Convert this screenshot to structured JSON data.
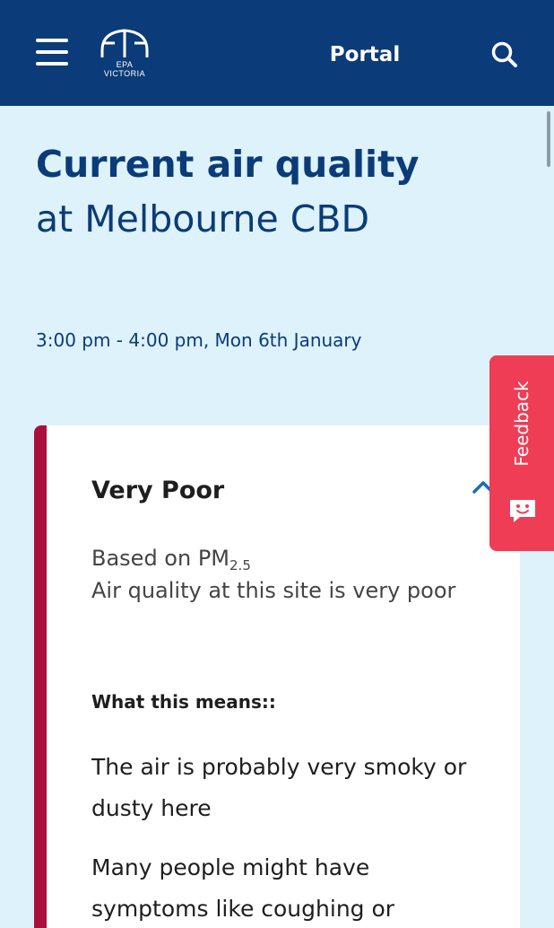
{
  "header": {
    "logo_primary": "EPA",
    "logo_secondary": "VICTORIA",
    "nav_link": "Portal",
    "icons": {
      "menu": "hamburger-menu-icon",
      "search": "search-icon"
    }
  },
  "page": {
    "title_strong": "Current air quality",
    "title_light": "at Melbourne CBD",
    "time_range": "3:00 pm - 4:00 pm, Mon 6th January"
  },
  "card": {
    "status": "Very Poor",
    "based_on": "Based on PM",
    "based_on_sub": "2.5",
    "description": "Air quality at this site is very poor",
    "means_heading": "What this means::",
    "paragraphs": [
      "The air is probably very smoky or dusty here",
      "Many people might have symptoms like coughing or"
    ],
    "accent_color": "#ab0f3b",
    "toggle_icon": "chevron-up-icon"
  },
  "feedback": {
    "label": "Feedback",
    "icon": "smiley-face-icon",
    "color": "#ef3d55"
  },
  "colors": {
    "header_bg": "#0b3b78",
    "page_bg": "#ddf2fa",
    "heading_text": "#0b3b78"
  }
}
